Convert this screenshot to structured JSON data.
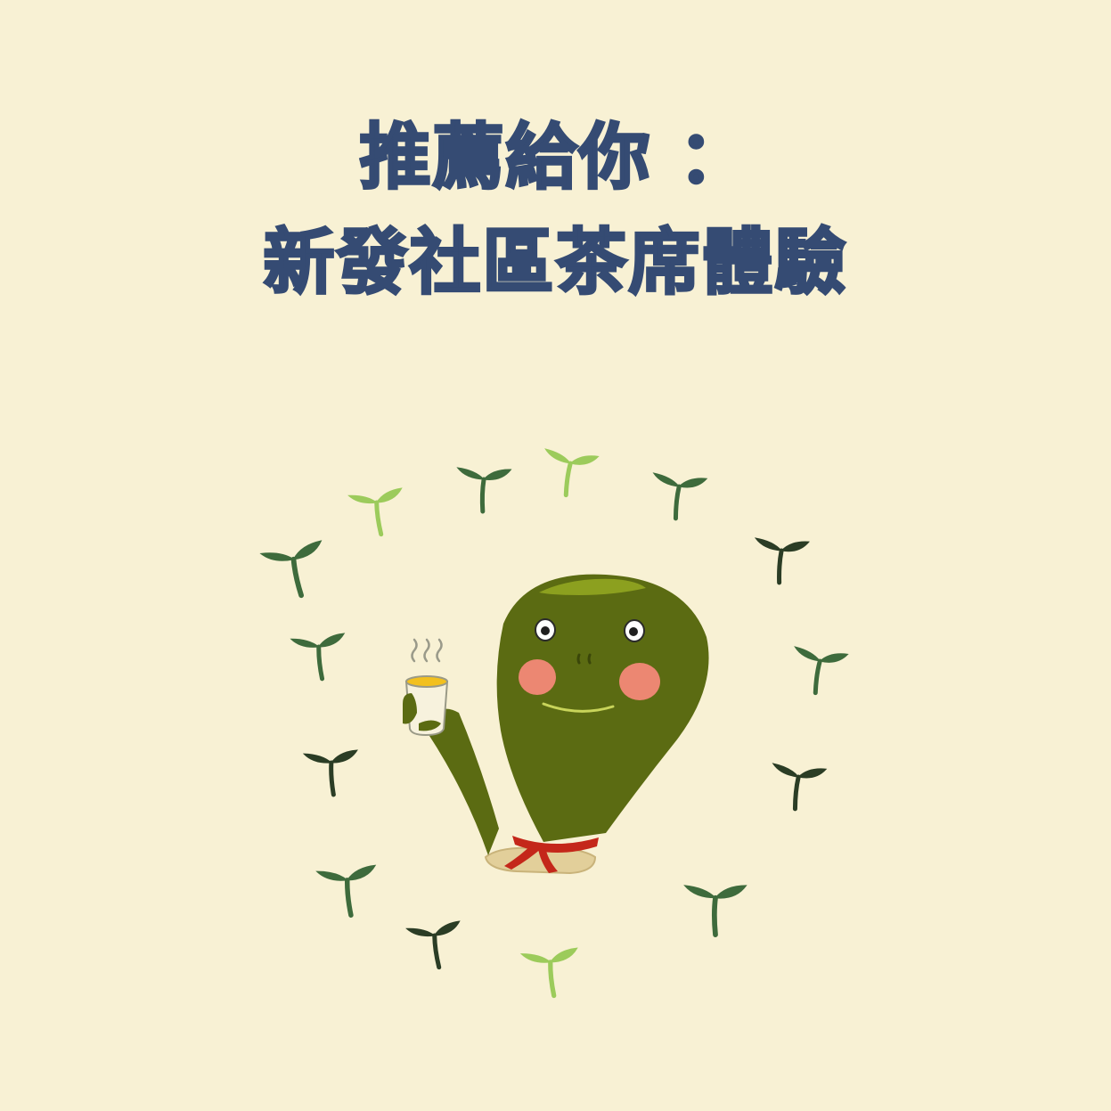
{
  "background_color": "#f8f1d4",
  "title": {
    "line1": "推薦給你 ：",
    "line2": "新發社區茶席體驗",
    "color": "#354b73"
  },
  "illustration": {
    "icon": "tea-sprout-mascot-holding-tea-cup",
    "sprout_colors": {
      "dark": "#2b3d25",
      "mid": "#3e6b3c",
      "light": "#9ccb5b"
    },
    "mascot_color": "#5b6b12",
    "scarf_color": "#c4271a"
  }
}
